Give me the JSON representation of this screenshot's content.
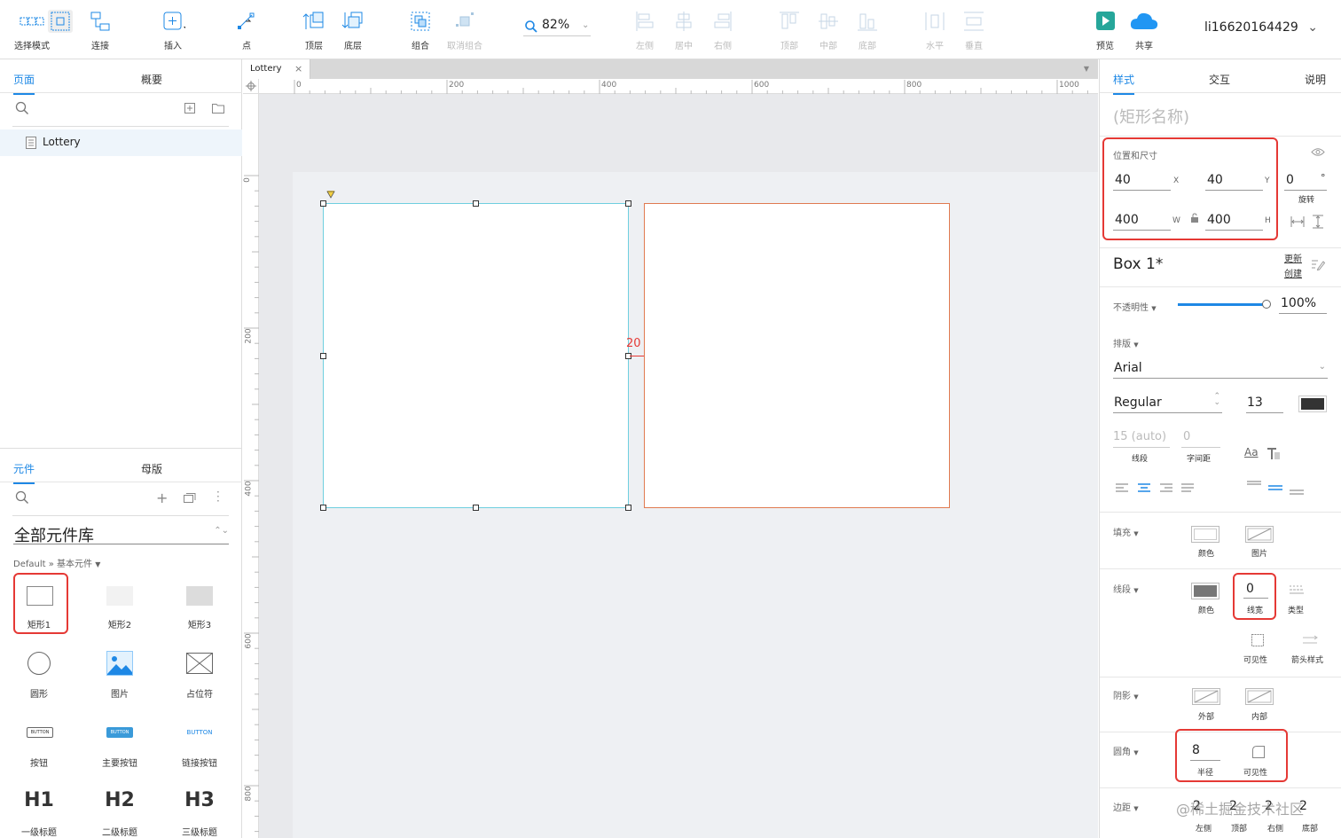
{
  "toolbar": {
    "select_mode": "选择模式",
    "connect": "连接",
    "insert": "插入",
    "point": "点",
    "top_layer": "顶层",
    "bottom_layer": "底层",
    "group": "组合",
    "ungroup": "取消组合",
    "zoom": "82%",
    "align_left": "左侧",
    "align_center": "居中",
    "align_right": "右侧",
    "align_top": "顶部",
    "align_middle": "中部",
    "align_bottom": "底部",
    "dist_h": "水平",
    "dist_v": "垂直",
    "preview": "预览",
    "share": "共享",
    "user": "li16620164429"
  },
  "left": {
    "tabs": [
      "页面",
      "概要"
    ],
    "page": "Lottery",
    "lib_tabs": [
      "元件",
      "母版"
    ],
    "library_select": "全部元件库",
    "library_path": "Default » 基本元件",
    "widgets": [
      "矩形1",
      "矩形2",
      "矩形3",
      "圆形",
      "图片",
      "占位符",
      "按钮",
      "主要按钮",
      "链接按钮",
      "一级标题",
      "二级标题",
      "三级标题"
    ],
    "button_text": "BUTTON",
    "headings": [
      "H1",
      "H2",
      "H3"
    ]
  },
  "canvas": {
    "tab": "Lottery",
    "ruler_h": [
      "0",
      "200",
      "400",
      "600",
      "800",
      "1000"
    ],
    "ruler_v": [
      "0",
      "200",
      "400",
      "600",
      "800"
    ],
    "gap_label": "20"
  },
  "right": {
    "tabs": [
      "样式",
      "交互",
      "说明"
    ],
    "shape_name_placeholder": "(矩形名称)",
    "pos_size_label": "位置和尺寸",
    "x": "40",
    "x_label": "X",
    "y": "40",
    "y_label": "Y",
    "w": "400",
    "w_label": "W",
    "h": "400",
    "h_label": "H",
    "rotation": "0",
    "rotation_unit": "°",
    "rotation_label": "旋转",
    "style_name": "Box 1*",
    "update": "更新",
    "create": "创建",
    "opacity_label": "不透明性",
    "opacity": "100%",
    "opacity_value": 1.0,
    "typography_label": "排版",
    "font": "Arial",
    "weight": "Regular",
    "font_size": "13",
    "line_height": "15 (auto)",
    "line_height_label": "线段",
    "char_spacing": "0",
    "char_spacing_label": "字间距",
    "fill_label": "填充",
    "fill_color_label": "颜色",
    "fill_image_label": "图片",
    "stroke_label": "线段",
    "stroke_color_label": "颜色",
    "stroke_width": "0",
    "stroke_width_label": "线宽",
    "stroke_type_label": "类型",
    "visibility_label": "可见性",
    "arrow_label": "箭头样式",
    "shadow_label": "阴影",
    "shadow_outer": "外部",
    "shadow_inner": "内部",
    "corner_label": "圆角",
    "corner_radius": "8",
    "corner_radius_label": "半径",
    "corner_visibility": "可见性",
    "padding_label": "边距",
    "padding_values": [
      "2",
      "2",
      "2",
      "2"
    ],
    "padding_names": [
      "左侧",
      "顶部",
      "右侧",
      "底部"
    ]
  },
  "watermark": "@稀土掘金技术社区",
  "colors": {
    "accent": "#1e88e5",
    "highlight": "#e53935",
    "selection": "#5bc0de",
    "neighbor_border": "#e07a50"
  }
}
